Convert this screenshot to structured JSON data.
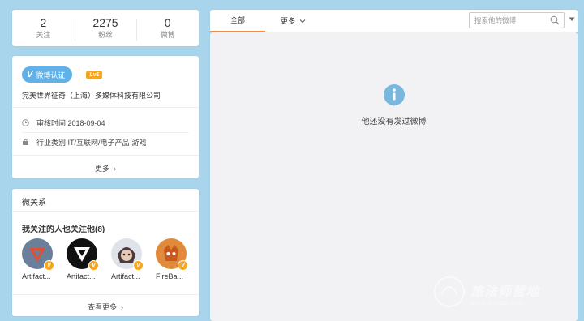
{
  "stats": [
    {
      "num": "2",
      "label": "关注"
    },
    {
      "num": "2275",
      "label": "粉丝"
    },
    {
      "num": "0",
      "label": "微博"
    }
  ],
  "info": {
    "verify_label": "微博认证",
    "level": "Lv1",
    "company": "完美世界征奇（上海）多媒体科技有限公司",
    "review_time": "审核时间 2018-09-04",
    "industry": "行业类别 IT/互联网/电子产品-游戏",
    "more": "更多"
  },
  "relations": {
    "title": "微关系",
    "subtitle": "我关注的人也关注他(8)",
    "users": [
      {
        "name": "Artifact..."
      },
      {
        "name": "Artifact..."
      },
      {
        "name": "Artifact..."
      },
      {
        "name": "FireBa..."
      }
    ],
    "view_more": "查看更多"
  },
  "tabs": {
    "all": "全部",
    "more": "更多",
    "search_placeholder": "搜索他的微博"
  },
  "feed": {
    "empty_text": "他还没有发过微博"
  },
  "watermark": {
    "text": "旅法师营地",
    "url": "www.iyingdi.com"
  },
  "colors": {
    "background": "#a8d4ec",
    "accent_tab": "#f28a44",
    "verify_blue": "#5fb1e8",
    "badge_orange": "#f5a623",
    "info_icon": "#79b8de"
  }
}
